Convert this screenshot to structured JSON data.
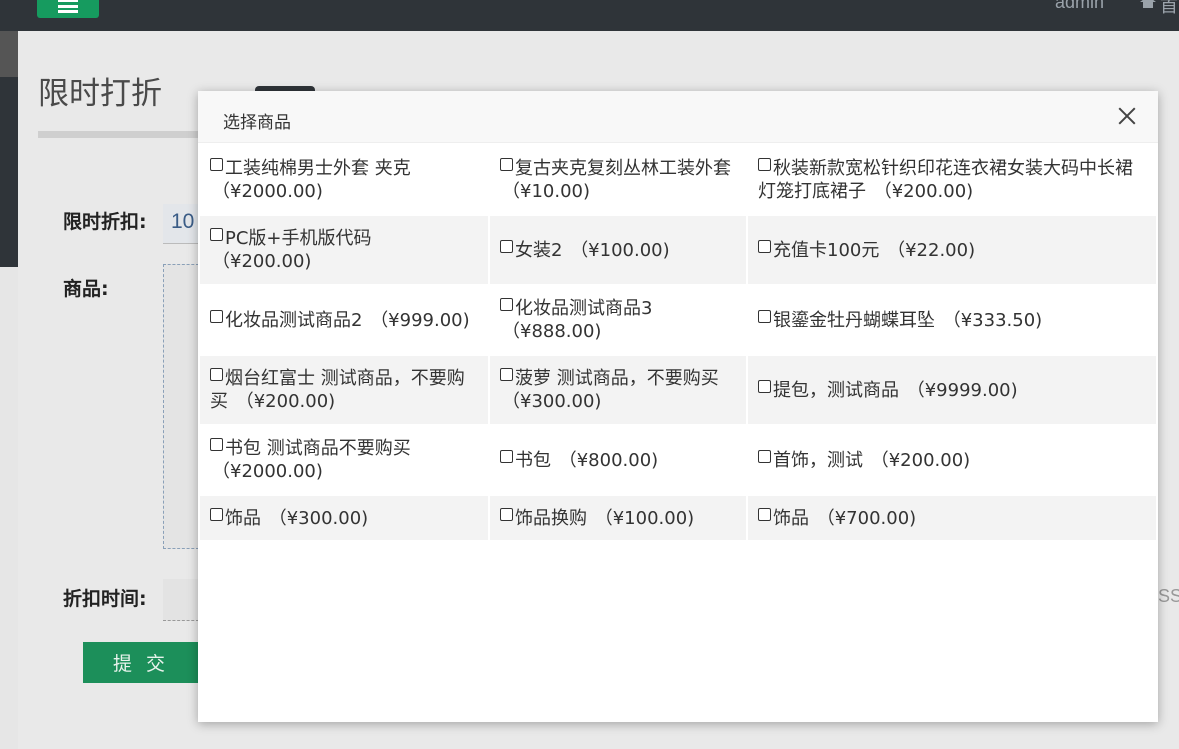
{
  "header": {
    "user": "admin",
    "home_label": "首"
  },
  "page": {
    "title": "限时打折",
    "discount_label": "限时折扣:",
    "discount_value": "10",
    "goods_label": "商品:",
    "time_label": "折扣时间:",
    "submit_label": "提 交",
    "right_fragment": "SS"
  },
  "modal": {
    "title": "选择商品",
    "rows": [
      {
        "cells": [
          {
            "name": "工装纯棉男士外套 夹克",
            "price": "（¥2000.00)"
          },
          {
            "name": "复古夹克复刻丛林工装外套",
            "price": "（¥10.00)"
          },
          {
            "name": "秋装新款宽松针织印花连衣裙女装大码中长裙灯笼打底裙子",
            "price": "（¥200.00)"
          }
        ]
      },
      {
        "cells": [
          {
            "name": "PC版+手机版代码",
            "price": "（¥200.00)"
          },
          {
            "name": "女装2",
            "price": "（¥100.00)"
          },
          {
            "name": "充值卡100元",
            "price": "（¥22.00)"
          }
        ]
      },
      {
        "cells": [
          {
            "name": "化妆品测试商品2",
            "price": "（¥999.00)"
          },
          {
            "name": "化妆品测试商品3",
            "price": "（¥888.00)"
          },
          {
            "name": "银鎏金牡丹蝴蝶耳坠",
            "price": "（¥333.50)"
          }
        ]
      },
      {
        "cells": [
          {
            "name": "烟台红富士 测试商品，不要购买",
            "price": "（¥200.00)"
          },
          {
            "name": "菠萝 测试商品，不要购买",
            "price": "（¥300.00)"
          },
          {
            "name": "提包，测试商品",
            "price": "（¥9999.00)"
          }
        ]
      },
      {
        "cells": [
          {
            "name": "书包 测试商品不要购买",
            "price": "（¥2000.00)"
          },
          {
            "name": "书包",
            "price": "（¥800.00)"
          },
          {
            "name": "首饰，测试",
            "price": "（¥200.00)"
          }
        ]
      },
      {
        "cells": [
          {
            "name": "饰品",
            "price": "（¥300.00)"
          },
          {
            "name": "饰品换购",
            "price": "（¥100.00)"
          },
          {
            "name": "饰品",
            "price": "（¥700.00)"
          }
        ]
      }
    ]
  },
  "colors": {
    "navbar": "#2f3439",
    "accent_green": "#1c8f5a"
  },
  "icons": [
    "menu-icon",
    "home-icon",
    "close-icon",
    "checkbox"
  ]
}
